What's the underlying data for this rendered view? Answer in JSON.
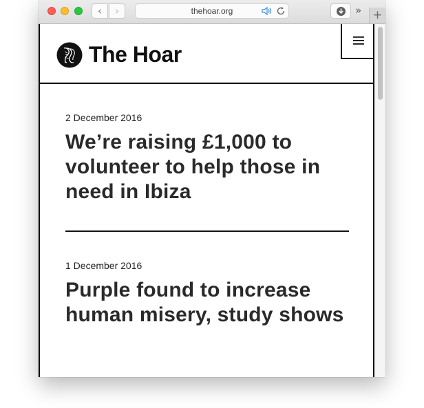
{
  "browser": {
    "url": "thehoar.org",
    "back_glyph": "‹",
    "forward_glyph": "›",
    "overflow_glyph": "»",
    "newtab_glyph": "+"
  },
  "site": {
    "title": "The Hoar",
    "logo_icon": "legs-circle-logo",
    "menu_icon": "hamburger-menu-icon"
  },
  "articles": [
    {
      "date": "2 December 2016",
      "title": "We’re raising £1,000 to volunteer to help those in need in Ibiza"
    },
    {
      "date": "1 December 2016",
      "title": "Purple found to increase human misery, study shows"
    }
  ],
  "colors": {
    "text": "#111111",
    "heading": "#2a2a2a",
    "traffic_red": "#fc5f57",
    "traffic_yellow": "#fdbc2e",
    "traffic_green": "#28c840"
  }
}
